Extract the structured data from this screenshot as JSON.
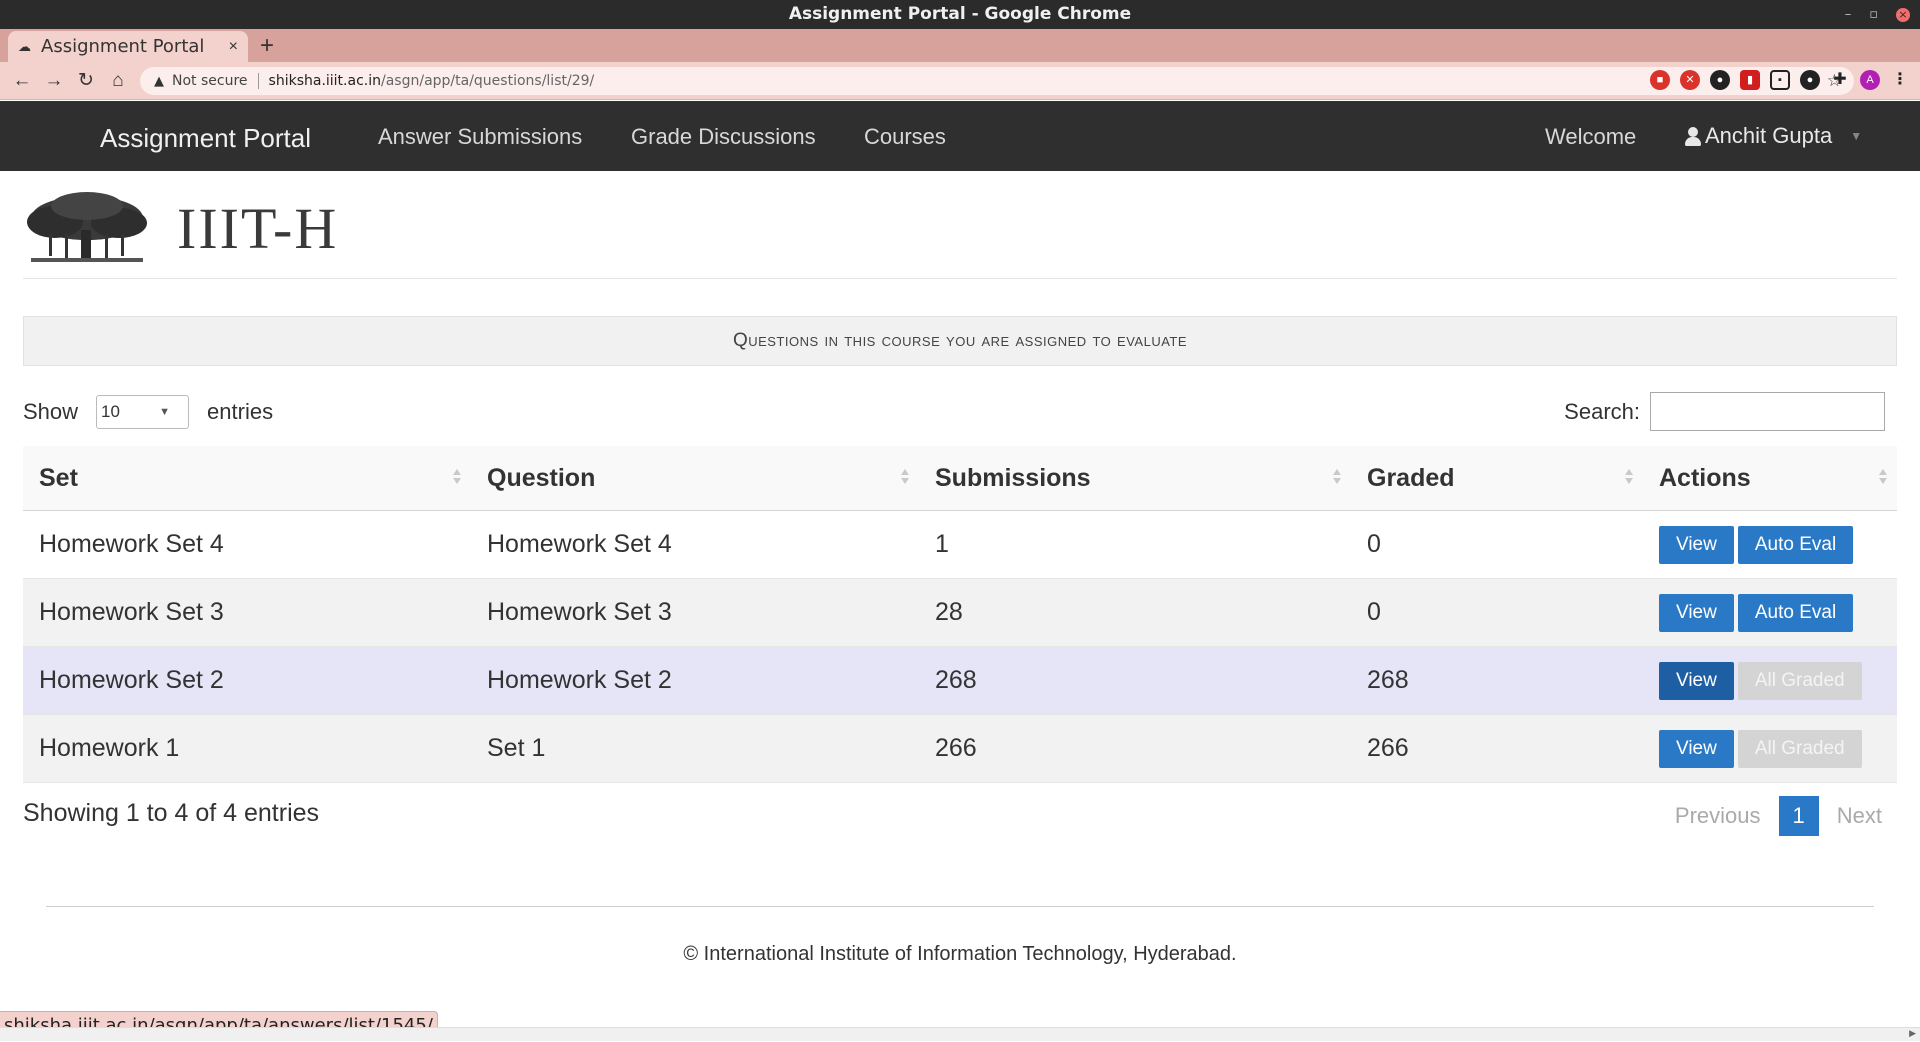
{
  "window": {
    "title": "Assignment Portal - Google Chrome",
    "controls": [
      "–",
      "▫",
      "×"
    ]
  },
  "tab": {
    "title": "Assignment Portal",
    "close": "×",
    "new_tab": "+"
  },
  "toolbar": {
    "not_secure": "Not secure",
    "url_host": "shiksha.iiit.ac.in",
    "url_path": "/asgn/app/ta/questions/list/29/",
    "profile_initial": "A"
  },
  "navbar": {
    "brand": "Assignment Portal",
    "links": [
      "Answer Submissions",
      "Grade Discussions",
      "Courses"
    ],
    "welcome": "Welcome",
    "user": "Anchit Gupta"
  },
  "logo": {
    "text": "IIIT-H"
  },
  "panel": {
    "heading": "Questions in this course you are assigned to evaluate"
  },
  "table_controls": {
    "show_label": "Show",
    "page_length": "10",
    "entries_label": "entries",
    "search_label": "Search:",
    "search_value": ""
  },
  "table": {
    "columns": [
      "Set",
      "Question",
      "Submissions",
      "Graded",
      "Actions"
    ],
    "rows": [
      {
        "set": "Homework Set 4",
        "question": "Homework Set 4",
        "submissions": "1",
        "graded": "0",
        "view": "View",
        "action2": "Auto Eval",
        "action2_enabled": true
      },
      {
        "set": "Homework Set 3",
        "question": "Homework Set 3",
        "submissions": "28",
        "graded": "0",
        "view": "View",
        "action2": "Auto Eval",
        "action2_enabled": true
      },
      {
        "set": "Homework Set 2",
        "question": "Homework Set 2",
        "submissions": "268",
        "graded": "268",
        "view": "View",
        "action2": "All Graded",
        "action2_enabled": false
      },
      {
        "set": "Homework 1",
        "question": "Set 1",
        "submissions": "266",
        "graded": "266",
        "view": "View",
        "action2": "All Graded",
        "action2_enabled": false
      }
    ]
  },
  "info": "Showing 1 to 4 of 4 entries",
  "pagination": {
    "previous": "Previous",
    "current": "1",
    "next": "Next"
  },
  "footer": "© International Institute of Information Technology, Hyderabad.",
  "status_bar": "shiksha.iiit.ac.in/asgn/app/ta/answers/list/1545/",
  "colors": {
    "navbar_bg": "#2f2f2f",
    "primary_button": "#2a79c7",
    "disabled_button": "#d4d4d4",
    "hover_row": "#e6e4f7",
    "chrome_tab_accent": "#d8a29c"
  }
}
